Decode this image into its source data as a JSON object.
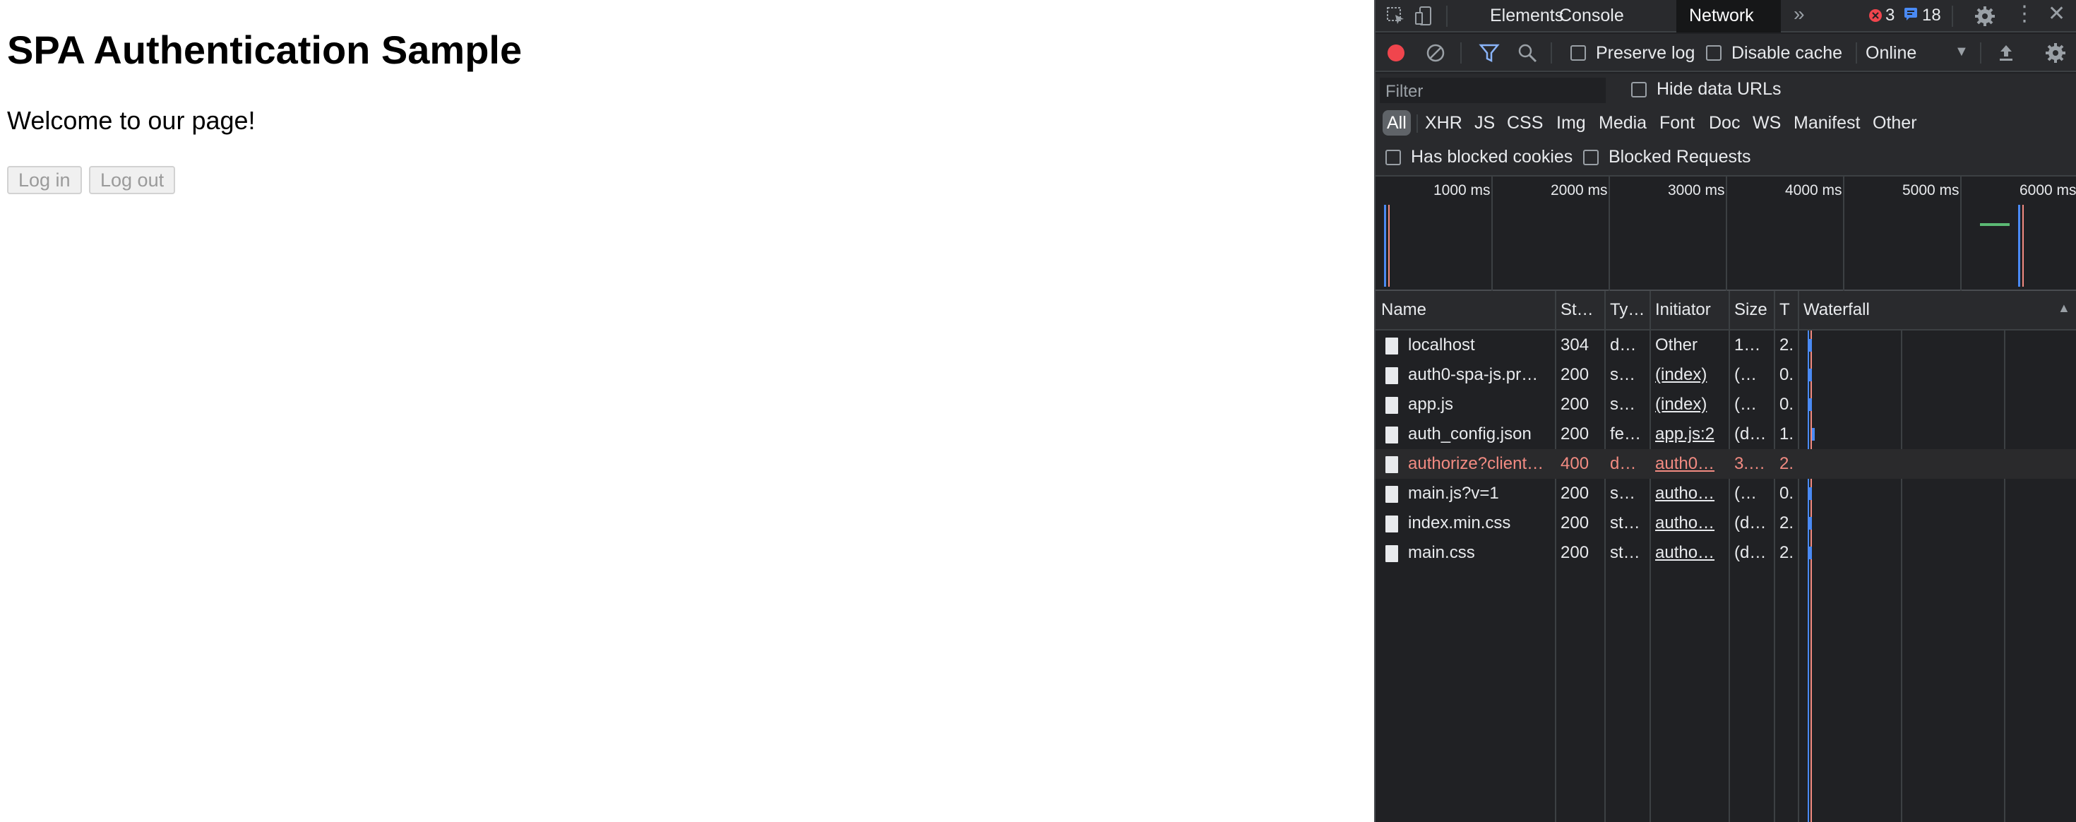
{
  "page": {
    "title": "SPA Authentication Sample",
    "welcome": "Welcome to our page!",
    "login_label": "Log in",
    "logout_label": "Log out"
  },
  "devtools": {
    "tabs": [
      "Elements",
      "Console",
      "Network"
    ],
    "active_tab": "Network",
    "error_count": "3",
    "message_count": "18",
    "toolbar": {
      "preserve_log": "Preserve log",
      "disable_cache": "Disable cache",
      "throttling": "Online"
    },
    "filter": {
      "placeholder": "Filter",
      "hide_data_urls": "Hide data URLs",
      "types": [
        "All",
        "XHR",
        "JS",
        "CSS",
        "Img",
        "Media",
        "Font",
        "Doc",
        "WS",
        "Manifest",
        "Other"
      ],
      "selected_type": "All",
      "has_blocked_cookies": "Has blocked cookies",
      "blocked_requests": "Blocked Requests"
    },
    "overview_ticks": [
      "1000 ms",
      "2000 ms",
      "3000 ms",
      "4000 ms",
      "5000 ms",
      "6000 ms"
    ],
    "columns": {
      "name": "Name",
      "status": "St…",
      "type": "Ty…",
      "initiator": "Initiator",
      "size": "Size",
      "time": "T",
      "waterfall": "Waterfall"
    },
    "requests": [
      {
        "name": "localhost",
        "status": "304",
        "type": "d…",
        "initiator": "Other",
        "size": "1…",
        "time": "2.",
        "error": false,
        "link": false
      },
      {
        "name": "auth0-spa-js.pr…",
        "status": "200",
        "type": "s…",
        "initiator": "(index)",
        "size": "(…",
        "time": "0.",
        "error": false,
        "link": true
      },
      {
        "name": "app.js",
        "status": "200",
        "type": "s…",
        "initiator": "(index)",
        "size": "(…",
        "time": "0.",
        "error": false,
        "link": true
      },
      {
        "name": "auth_config.json",
        "status": "200",
        "type": "fe…",
        "initiator": "app.js:2",
        "size": "(d…",
        "time": "1.",
        "error": false,
        "link": true
      },
      {
        "name": "authorize?client…",
        "status": "400",
        "type": "d…",
        "initiator": "auth0…",
        "size": "3.…",
        "time": "2.",
        "error": true,
        "link": true
      },
      {
        "name": "main.js?v=1",
        "status": "200",
        "type": "s…",
        "initiator": "autho…",
        "size": "(…",
        "time": "0.",
        "error": false,
        "link": true
      },
      {
        "name": "index.min.css",
        "status": "200",
        "type": "st…",
        "initiator": "autho…",
        "size": "(d…",
        "time": "2.",
        "error": false,
        "link": true
      },
      {
        "name": "main.css",
        "status": "200",
        "type": "st…",
        "initiator": "autho…",
        "size": "(d…",
        "time": "2.",
        "error": false,
        "link": true
      }
    ],
    "colors": {
      "record": "#f0454d",
      "error_text": "#f28b82",
      "accent_blue": "#4a8af4",
      "active_filter": "#8ab4f8"
    }
  }
}
